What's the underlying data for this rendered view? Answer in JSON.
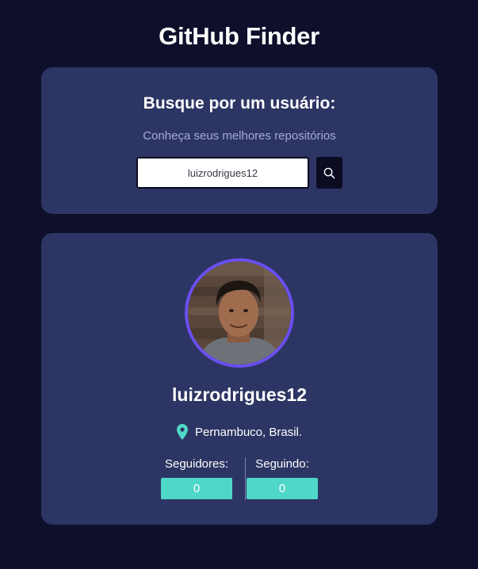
{
  "app_title": "GitHub Finder",
  "search": {
    "heading": "Busque por um usuário:",
    "subheading": "Conheça seus melhores repositórios",
    "input_value": "luizrodrigues12",
    "button_icon": "search-icon"
  },
  "profile": {
    "avatar_alt": "luizrodrigues12",
    "username": "luizrodrigues12",
    "location_icon": "location-pin-icon",
    "location": "Pernambuco, Brasil.",
    "followers_label": "Seguidores:",
    "followers_count": "0",
    "following_label": "Seguindo:",
    "following_count": "0"
  },
  "colors": {
    "background": "#0e0f2a",
    "card": "#2c3563",
    "accent_purple": "#6a4ff0",
    "accent_teal": "#4fd8c8",
    "subtext": "#a6abd8"
  }
}
